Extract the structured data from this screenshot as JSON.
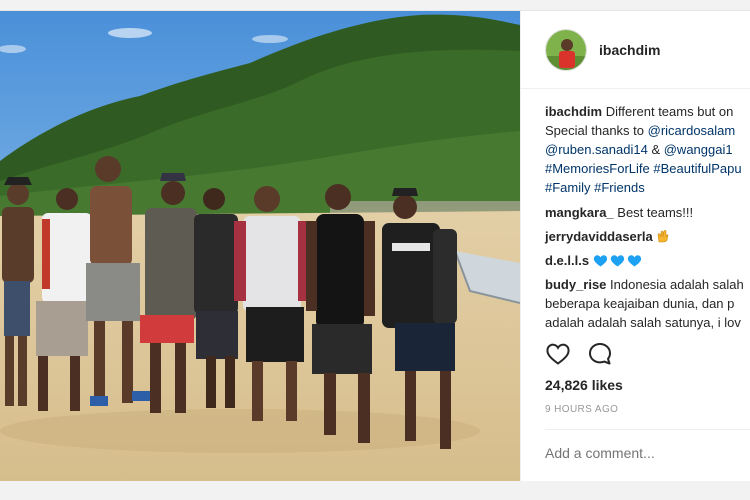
{
  "post": {
    "username": "ibachdim",
    "caption_lines": [
      {
        "user": "ibachdim",
        "text": " Different teams but on"
      },
      {
        "text": "Special thanks to ",
        "link": "@ricardosalam"
      },
      {
        "link": "@ruben.sanadi14",
        "text": " & ",
        "link2": "@wanggai1"
      },
      {
        "link": "#MemoriesForLife #BeautifulPapu"
      },
      {
        "link": "#Family #Friends"
      }
    ],
    "comments": [
      {
        "user": "mangkara_",
        "text": " Best teams!!!"
      },
      {
        "user": "jerrydaviddaserla",
        "text": " ",
        "emoji": "raised-hands"
      },
      {
        "user": "d.e.l.l.s",
        "text": " ",
        "emoji": "blue-hearts-x3"
      },
      {
        "user": "budy_rise",
        "text": " Indonesia adalah salah",
        "more": [
          "beberapa keajaiban dunia, dan p",
          "adalah adalah salah satunya, i lov"
        ]
      }
    ],
    "likes": "24,826 likes",
    "time": "9 HOURS AGO",
    "add_comment_placeholder": "Add a comment...",
    "icons": {
      "like": "heart-outline-icon",
      "comment": "comment-bubble-icon"
    },
    "colors": {
      "link": "#003569",
      "heart_emoji": "#1da1f2"
    }
  }
}
